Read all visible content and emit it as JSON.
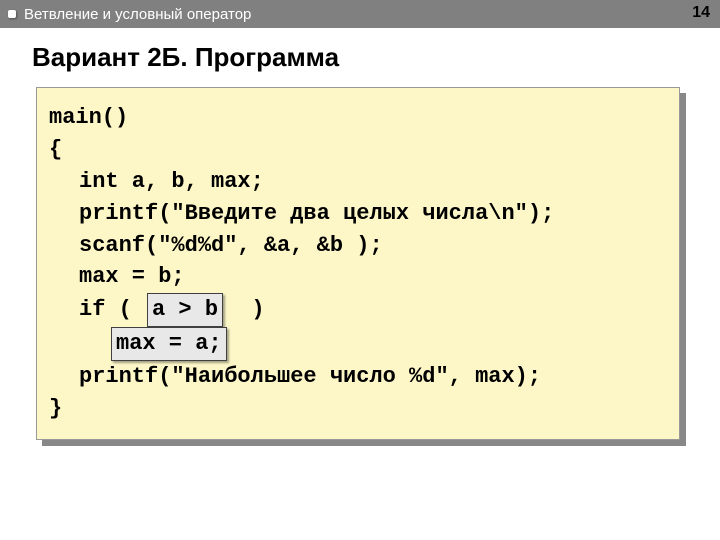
{
  "header": {
    "title": "Ветвление и условный оператор",
    "page_number": "14"
  },
  "slide": {
    "title": "Вариант 2Б. Программа"
  },
  "code": {
    "l1": "main()",
    "l2": "{",
    "l3": "int a, b, max;",
    "l4": "printf(\"Введите два целых числа\\n\");",
    "l5": "scanf(\"%d%d\", &a, &b );",
    "l6": "max = b;",
    "l7_prefix": "if ( ",
    "l7_highlight": "a > b",
    "l7_suffix": "  )",
    "l8_highlight": "max = a;",
    "l9": "printf(\"Наибольшее число %d\", max);",
    "l10": "}"
  }
}
